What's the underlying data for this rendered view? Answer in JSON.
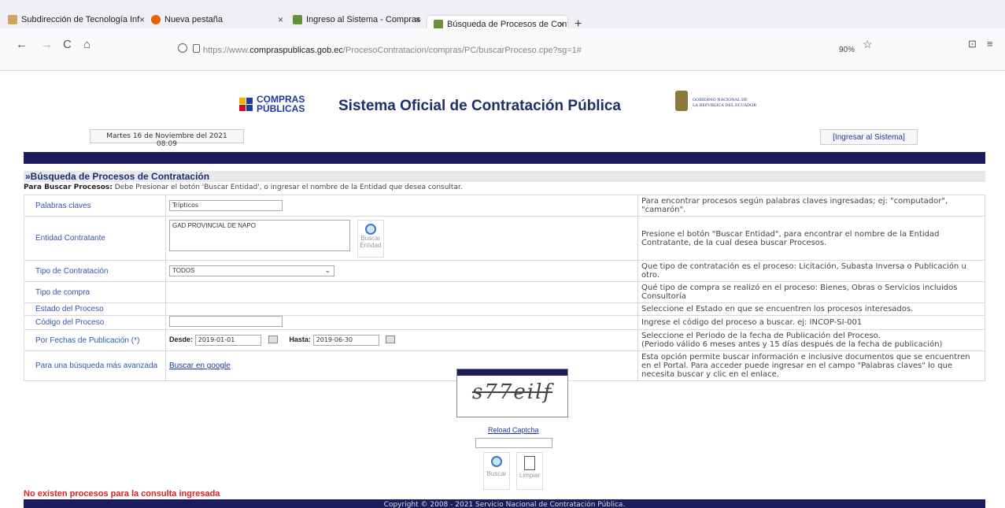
{
  "browser": {
    "tabs": [
      {
        "label": "Subdirección de Tecnología Inf",
        "close": "×"
      },
      {
        "label": "Nueva pestaña",
        "close": "×"
      },
      {
        "label": "Ingreso al Sistema - Compras P",
        "close": "×"
      },
      {
        "label": "Búsqueda de Procesos de Cont",
        "close": "×"
      }
    ],
    "new_tab": "+",
    "url_prefix": "https://www.",
    "url_domain": "compraspublicas.gob.ec",
    "url_path": "/ProcesoContratacion/compras/PC/buscarProceso.cpe?sg=1#",
    "zoom": "90%",
    "icons": {
      "back": "←",
      "forward": "→",
      "reload": "C",
      "home": "⌂",
      "star": "☆",
      "pocket": "⊡",
      "menu": "≡"
    }
  },
  "header": {
    "title": "Sistema Oficial de Contratación Pública",
    "logo_compras_line1": "COMPRAS",
    "logo_compras_line2": "PÚBLICAS",
    "logo_gob_line1": "GOBIERNO NACIONAL DE",
    "logo_gob_line2": "LA REPUBLICA DEL ECUADOR",
    "date": "Martes 16 de Noviembre del 2021 08:09",
    "login_link": "[Ingresar al Sistema]"
  },
  "section": {
    "title": "»Búsqueda de Procesos de Contratación",
    "instr_bold": "Para Buscar Procesos:",
    "instr_text": " Debe Presionar el botón 'Buscar Entidad', o ingresar el nombre de la Entidad que desea consultar."
  },
  "form": {
    "palabras": {
      "label": "Palabras claves",
      "value": "Trípticos",
      "help": "Para encontrar procesos según palabras claves ingresadas; ej: \"computador\", \"camarón\"."
    },
    "entidad": {
      "label": "Entidad Contratante",
      "value": "GAD PROVINCIAL DE NAPO",
      "btn1": "Buscar",
      "btn2": "Entidad",
      "help": "Presione el botón \"Buscar Entidad\", para encontrar el nombre de la Entidad Contratante, de la cual desea buscar Procesos."
    },
    "tipo": {
      "label": "Tipo de Contratación",
      "value": "TODOS",
      "help": "Que tipo de contratación es el proceso: Licitación, Subasta Inversa o Publicación u otro."
    },
    "tipo_compra": {
      "label": "Tipo de compra",
      "help": "Qué tipo de compra se realizó en el proceso: Bienes, Obras o Servicios incluidos Consultoría"
    },
    "estado": {
      "label": "Estado del Proceso",
      "help": "Seleccione el Estado en que se encuentren los procesos interesados."
    },
    "codigo": {
      "label": "Código del Proceso",
      "value": "",
      "help": "Ingrese el código del proceso a buscar. ej: INCOP-SI-001"
    },
    "fechas": {
      "label": "Por Fechas de Publicación (*)",
      "desde_label": "Desde:",
      "desde": "2019-01-01",
      "hasta_label": "Hasta:",
      "hasta": "2019-06-30",
      "help1": "Seleccione el Periodo de la fecha de Publicación del Proceso.",
      "help2": "(Periodo válido 6 meses antes y 15 días después de la fecha de publicación)"
    },
    "avanzada": {
      "label": "Para una búsqueda más avanzada",
      "link": "Buscar en google",
      "help": "Esta opción permite buscar información e inclusive documentos que se encuentren en el Portal. Para acceder puede ingresar en el campo \"Palabras claves\" lo que necesita buscar y clic en el enlace."
    }
  },
  "captcha": {
    "text": "s77eilf",
    "reload": "Reload Captcha",
    "buscar": "Buscar",
    "limpiar": "Limpiar"
  },
  "messages": {
    "noresult": "No existen procesos para la consulta ingresada",
    "footer": "Copyright © 2008 - 2021 Servicio Nacional de Contratación Pública."
  }
}
